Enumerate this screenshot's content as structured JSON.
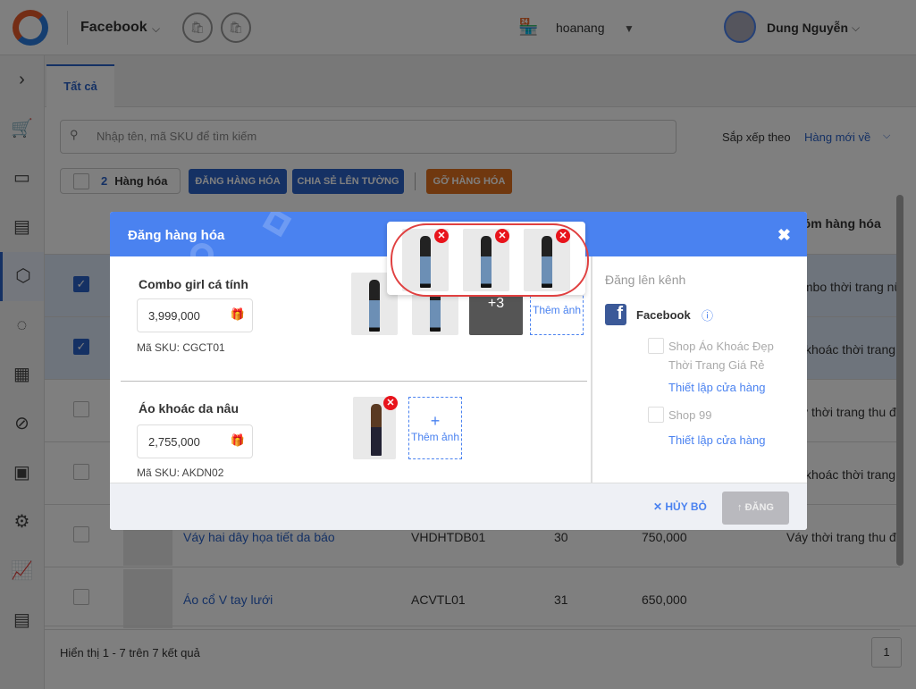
{
  "header": {
    "channel": "Facebook",
    "shop": "hoanang",
    "user": "Dung Nguyễn"
  },
  "tabs": [
    {
      "label": "Tất cả"
    }
  ],
  "search": {
    "placeholder": "Nhập tên, mã SKU để tìm kiếm"
  },
  "sort": {
    "label": "Sắp xếp theo",
    "value": "Hàng mới về"
  },
  "toolbar": {
    "count": "2",
    "count_label": "Hàng hóa",
    "post": "ĐĂNG HÀNG HÓA",
    "share": "CHIA SẺ LÊN TƯỜNG",
    "remove": "GỠ HÀNG HÓA"
  },
  "table": {
    "group_header": "Nhóm hàng hóa",
    "rows": [
      {
        "name": "",
        "sku": "",
        "qty": "",
        "price": "",
        "group": "Combo thời trang nữ",
        "checked": true
      },
      {
        "name": "",
        "sku": "",
        "qty": "",
        "price": "",
        "group": "Áo khoác thời trang",
        "checked": true
      },
      {
        "name": "",
        "sku": "",
        "qty": "",
        "price": "",
        "group": "Váy thời trang thu đông",
        "checked": false
      },
      {
        "name": "",
        "sku": "",
        "qty": "",
        "price": "",
        "group": "Áo khoác thời trang",
        "checked": false
      },
      {
        "name": "Váy hai dây họa tiết da báo",
        "sku": "VHDHTDB01",
        "qty": "30",
        "price": "750,000",
        "group": "Váy thời trang thu đông",
        "checked": false
      },
      {
        "name": "Áo cổ V tay lưới",
        "sku": "ACVTL01",
        "qty": "31",
        "price": "650,000",
        "group": "",
        "checked": false
      }
    ]
  },
  "footer": {
    "summary": "Hiển thị 1 - 7 trên 7 kết quả",
    "page": "1"
  },
  "modal": {
    "title": "Đăng hàng hóa",
    "products": [
      {
        "name": "Combo girl cá tính",
        "price": "3,999,000",
        "sku": "Mã SKU: CGCT01",
        "more": "+3",
        "add": "Thêm ảnh"
      },
      {
        "name": "Áo khoác da nâu",
        "price": "2,755,000",
        "sku": "Mã SKU: AKDN02",
        "add": "Thêm ảnh"
      }
    ],
    "channel_title": "Đăng lên kênh",
    "channel": "Facebook",
    "shops": [
      {
        "name": "Shop Áo Khoác Đẹp Thời Trang Giá Rẻ",
        "setup": "Thiết lập cửa hàng"
      },
      {
        "name": "Shop 99",
        "setup": "Thiết lập cửa hàng"
      }
    ],
    "cancel": "HỦY BỎ",
    "submit": "ĐĂNG"
  },
  "colors": {
    "primary": "#4a82f0",
    "brand": "#2a62c9",
    "danger": "#e8141c"
  }
}
